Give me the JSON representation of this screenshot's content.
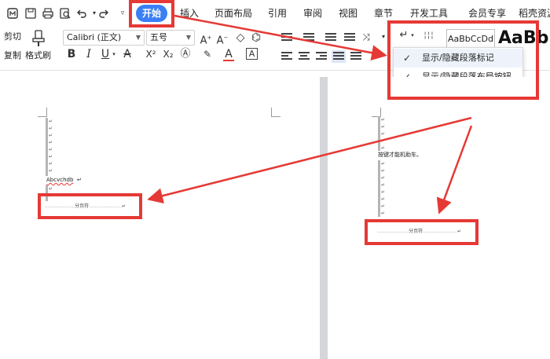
{
  "quick_access": {
    "icons": [
      "wps-home-icon",
      "save-icon",
      "print-icon",
      "print-preview-icon",
      "undo-icon",
      "redo-icon",
      "customize-qat-icon"
    ]
  },
  "menu": {
    "tabs": [
      "开始",
      "插入",
      "页面布局",
      "引用",
      "审阅",
      "视图",
      "章节",
      "开发工具",
      "会员专享",
      "稻壳资源"
    ],
    "active_tab_index": 0
  },
  "ribbon": {
    "clipboard": {
      "cut_label": "剪切",
      "copy_label": "复制",
      "format_painter_label": "格式刷"
    },
    "font": {
      "family": "Calibri (正文)",
      "size": "五号"
    },
    "format_buttons": {
      "bold": "B",
      "italic": "I",
      "underline": "U",
      "strikethrough": "A",
      "superscript": "X²",
      "subscript": "X₂",
      "font_color": "A",
      "char_border": "A"
    },
    "styles": {
      "preview_label": "AaBbCcDd",
      "big_preview_label": "AaBb"
    }
  },
  "paragraph_menu": {
    "items": [
      {
        "label": "显示/隐藏段落标记",
        "checked": true
      },
      {
        "label": "显示/隐藏段落布局按钮",
        "checked": true
      }
    ]
  },
  "document": {
    "left_page": {
      "text_line": "Abcvchdb",
      "page_break_label": "分页符"
    },
    "right_page": {
      "text_line": "按键才能机助车。",
      "page_break_label": "分页符"
    },
    "paragraph_mark": "↵"
  },
  "colors": {
    "accent_blue": "#3a7ff5",
    "annotation_red": "#e53935"
  }
}
